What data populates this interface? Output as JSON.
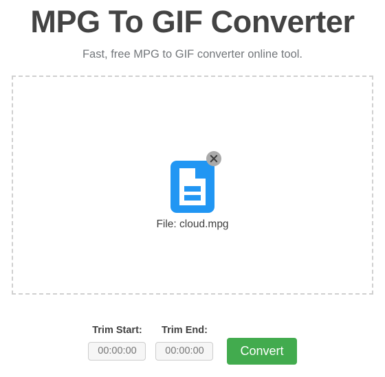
{
  "header": {
    "title": "MPG To GIF Converter",
    "subtitle": "Fast, free MPG to GIF converter online tool."
  },
  "dropzone": {
    "file": {
      "icon_name": "file-document-icon",
      "remove_icon_name": "close-circle-icon",
      "label": "File: cloud.mpg"
    }
  },
  "controls": {
    "trim_start": {
      "label": "Trim Start:",
      "value": "00:00:00",
      "placeholder": "00:00:00"
    },
    "trim_end": {
      "label": "Trim End:",
      "value": "00:00:00",
      "placeholder": "00:00:00"
    },
    "convert_label": "Convert"
  },
  "colors": {
    "accent_green": "#42ab4e",
    "file_icon_blue": "#2196f3",
    "title_gray": "#434343",
    "subtitle_gray": "#72767a",
    "dashed_border": "#cfcfcf",
    "remove_btn_gray": "#aaaaaa"
  }
}
